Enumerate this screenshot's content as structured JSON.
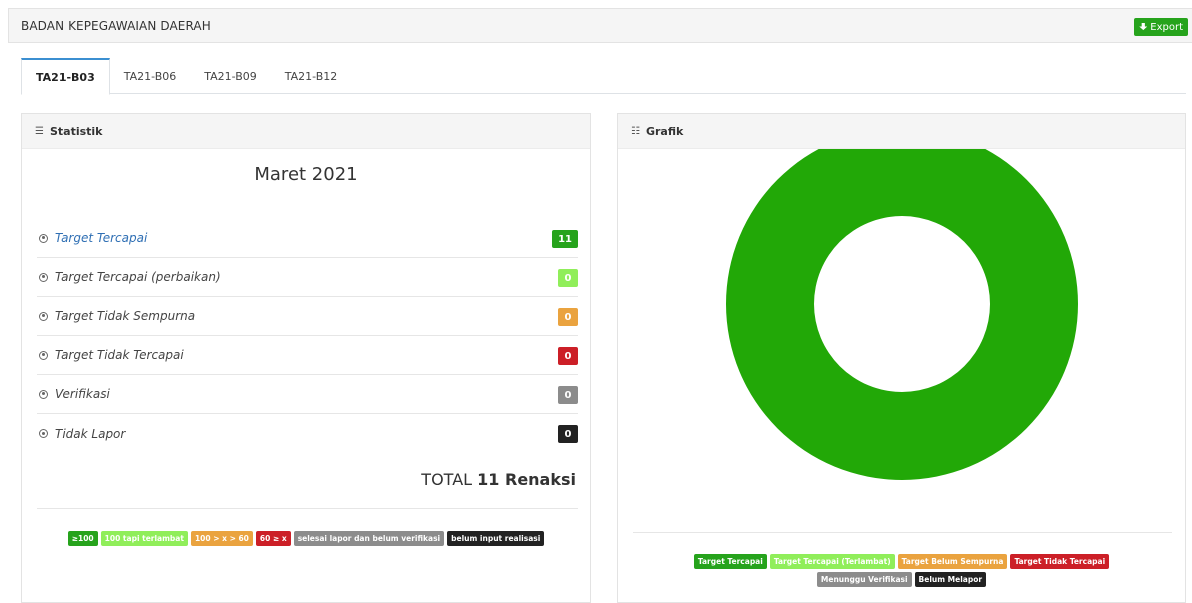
{
  "header": {
    "title": "BADAN KEPEGAWAIAN DAERAH",
    "export_label": "Export"
  },
  "tabs": [
    {
      "label": "TA21-B03",
      "active": true
    },
    {
      "label": "TA21-B06",
      "active": false
    },
    {
      "label": "TA21-B09",
      "active": false
    },
    {
      "label": "TA21-B12",
      "active": false
    }
  ],
  "statistik": {
    "header": "Statistik",
    "period": "Maret 2021",
    "items": [
      {
        "label": "Target Tercapai",
        "count": "11",
        "color": "#26a31c"
      },
      {
        "label": "Target Tercapai (perbaikan)",
        "count": "0",
        "color": "#90ee5a"
      },
      {
        "label": "Target Tidak Sempurna",
        "count": "0",
        "color": "#eaa33f"
      },
      {
        "label": "Target Tidak Tercapai",
        "count": "0",
        "color": "#cc1f27"
      },
      {
        "label": "Verifikasi",
        "count": "0",
        "color": "#8c8c8c"
      },
      {
        "label": "Tidak Lapor",
        "count": "0",
        "color": "#222222"
      }
    ],
    "total_prefix": "TOTAL",
    "total_value": "11 Renaksi",
    "legend": [
      {
        "label": "≥100",
        "color": "#26a31c"
      },
      {
        "label": "100 tapi terlambat",
        "color": "#90ee5a"
      },
      {
        "label": "100 > x > 60",
        "color": "#eaa33f"
      },
      {
        "label": "60 ≥ x",
        "color": "#cc1f27"
      },
      {
        "label": "selesai lapor dan belum verifikasi",
        "color": "#8c8c8c"
      },
      {
        "label": "belum input realisasi",
        "color": "#222222"
      }
    ]
  },
  "grafik": {
    "header": "Grafik",
    "legend": [
      {
        "label": "Target Tercapai",
        "color": "#26a31c"
      },
      {
        "label": "Target Tercapai (Terlambat)",
        "color": "#90ee5a"
      },
      {
        "label": "Target Belum Sempurna",
        "color": "#eaa33f"
      },
      {
        "label": "Target Tidak Tercapai",
        "color": "#cc1f27"
      },
      {
        "label": "Menunggu Verifikasi",
        "color": "#8c8c8c"
      },
      {
        "label": "Belum Melapor",
        "color": "#222222"
      }
    ]
  },
  "chart_data": {
    "type": "pie",
    "categories": [
      "Target Tercapai",
      "Target Tercapai (Terlambat)",
      "Target Belum Sempurna",
      "Target Tidak Tercapai",
      "Menunggu Verifikasi",
      "Belum Melapor"
    ],
    "values": [
      11,
      0,
      0,
      0,
      0,
      0
    ],
    "colors": [
      "#22a807",
      "#90ee5a",
      "#eaa33f",
      "#cc1f27",
      "#8c8c8c",
      "#222222"
    ],
    "donut": true,
    "legend": "bottom"
  }
}
